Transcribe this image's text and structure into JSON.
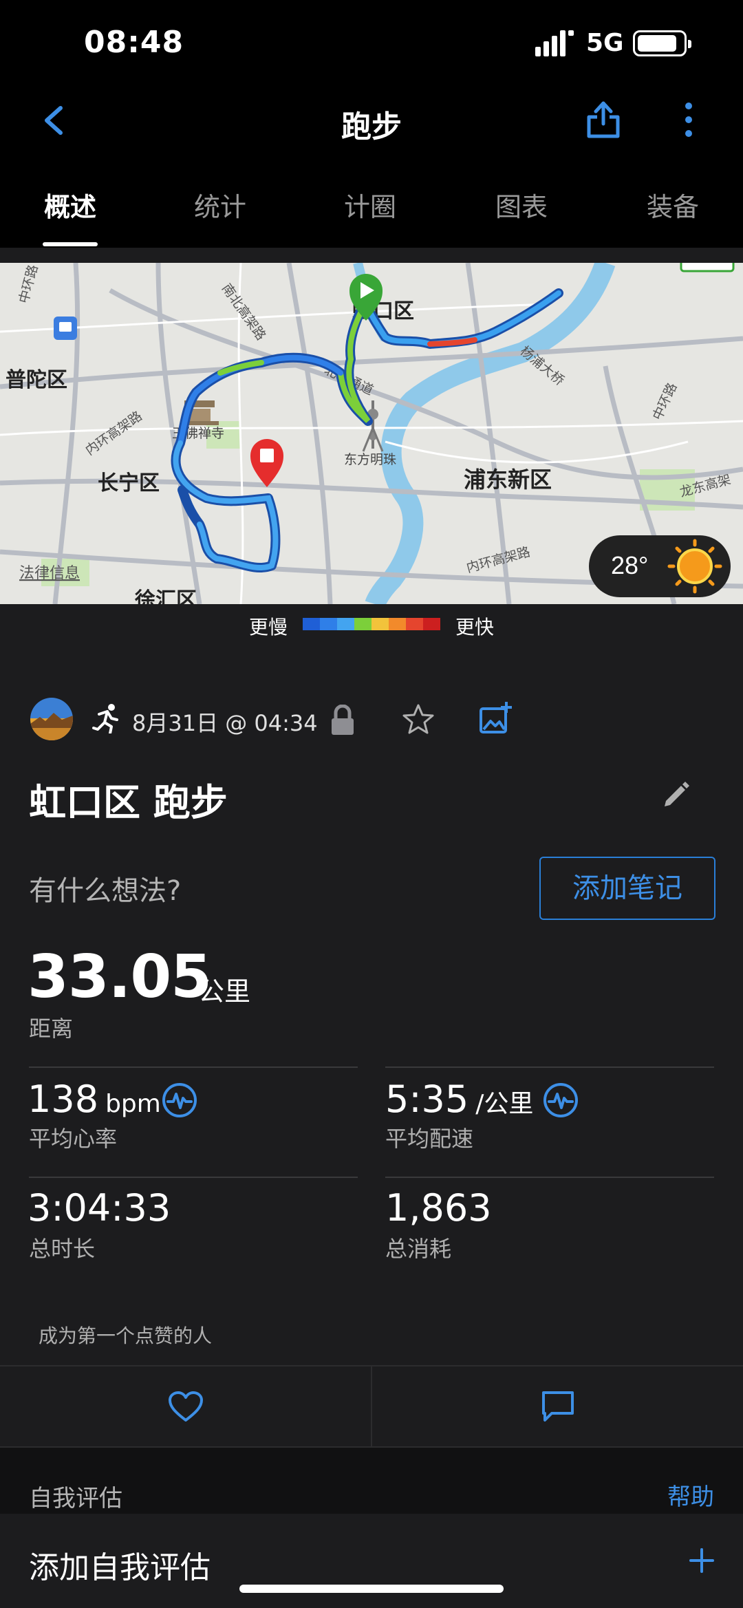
{
  "status_bar": {
    "time": "08:48",
    "network": "5G"
  },
  "nav": {
    "title": "跑步",
    "back_icon": "chevron-left-icon",
    "share_icon": "share-icon",
    "more_icon": "more-vertical-icon"
  },
  "tabs": [
    {
      "label": "概述",
      "active": true
    },
    {
      "label": "统计",
      "active": false
    },
    {
      "label": "计圈",
      "active": false
    },
    {
      "label": "图表",
      "active": false
    },
    {
      "label": "装备",
      "active": false
    }
  ],
  "map": {
    "districts": [
      "虹口区",
      "普陀区",
      "长宁区",
      "浦东新区",
      "徐汇区"
    ],
    "landmarks": [
      "玉佛禅寺",
      "东方明珠"
    ],
    "roads": [
      "南北高架路",
      "内环高架路",
      "北横通道",
      "杨浦大桥",
      "中环路",
      "龙东高架",
      "中环路",
      "内环高架路"
    ],
    "legal_link": "法律信息",
    "weather": {
      "temperature": "28°"
    }
  },
  "legend": {
    "slow": "更慢",
    "fast": "更快",
    "colors": [
      "#1f5fd6",
      "#2f7fe8",
      "#43a4f0",
      "#7ccf3a",
      "#f2c33b",
      "#f28a2b",
      "#e5452e",
      "#cc1f1f"
    ]
  },
  "activity": {
    "date": "8月31日 @ 04:34",
    "title": "虹口区 跑步",
    "thoughts_prompt": "有什么想法?",
    "add_note": "添加笔记",
    "distance": {
      "value": "33.05",
      "unit": "公里",
      "label": "距离"
    },
    "stats": [
      {
        "value": "138",
        "unit": "bpm",
        "label": "平均心率",
        "icon": "heart-rate-icon"
      },
      {
        "value": "5:35",
        "unit": "/公里",
        "label": "平均配速",
        "icon": "pace-icon"
      },
      {
        "value": "3:04:33",
        "unit": "",
        "label": "总时长"
      },
      {
        "value": "1,863",
        "unit": "",
        "label": "总消耗"
      }
    ],
    "likes_text": "成为第一个点赞的人"
  },
  "self_eval": {
    "title": "自我评估",
    "help": "帮助",
    "add_label": "添加自我评估"
  },
  "colors": {
    "accent": "#3d8fe6",
    "background": "#1c1c1e"
  }
}
